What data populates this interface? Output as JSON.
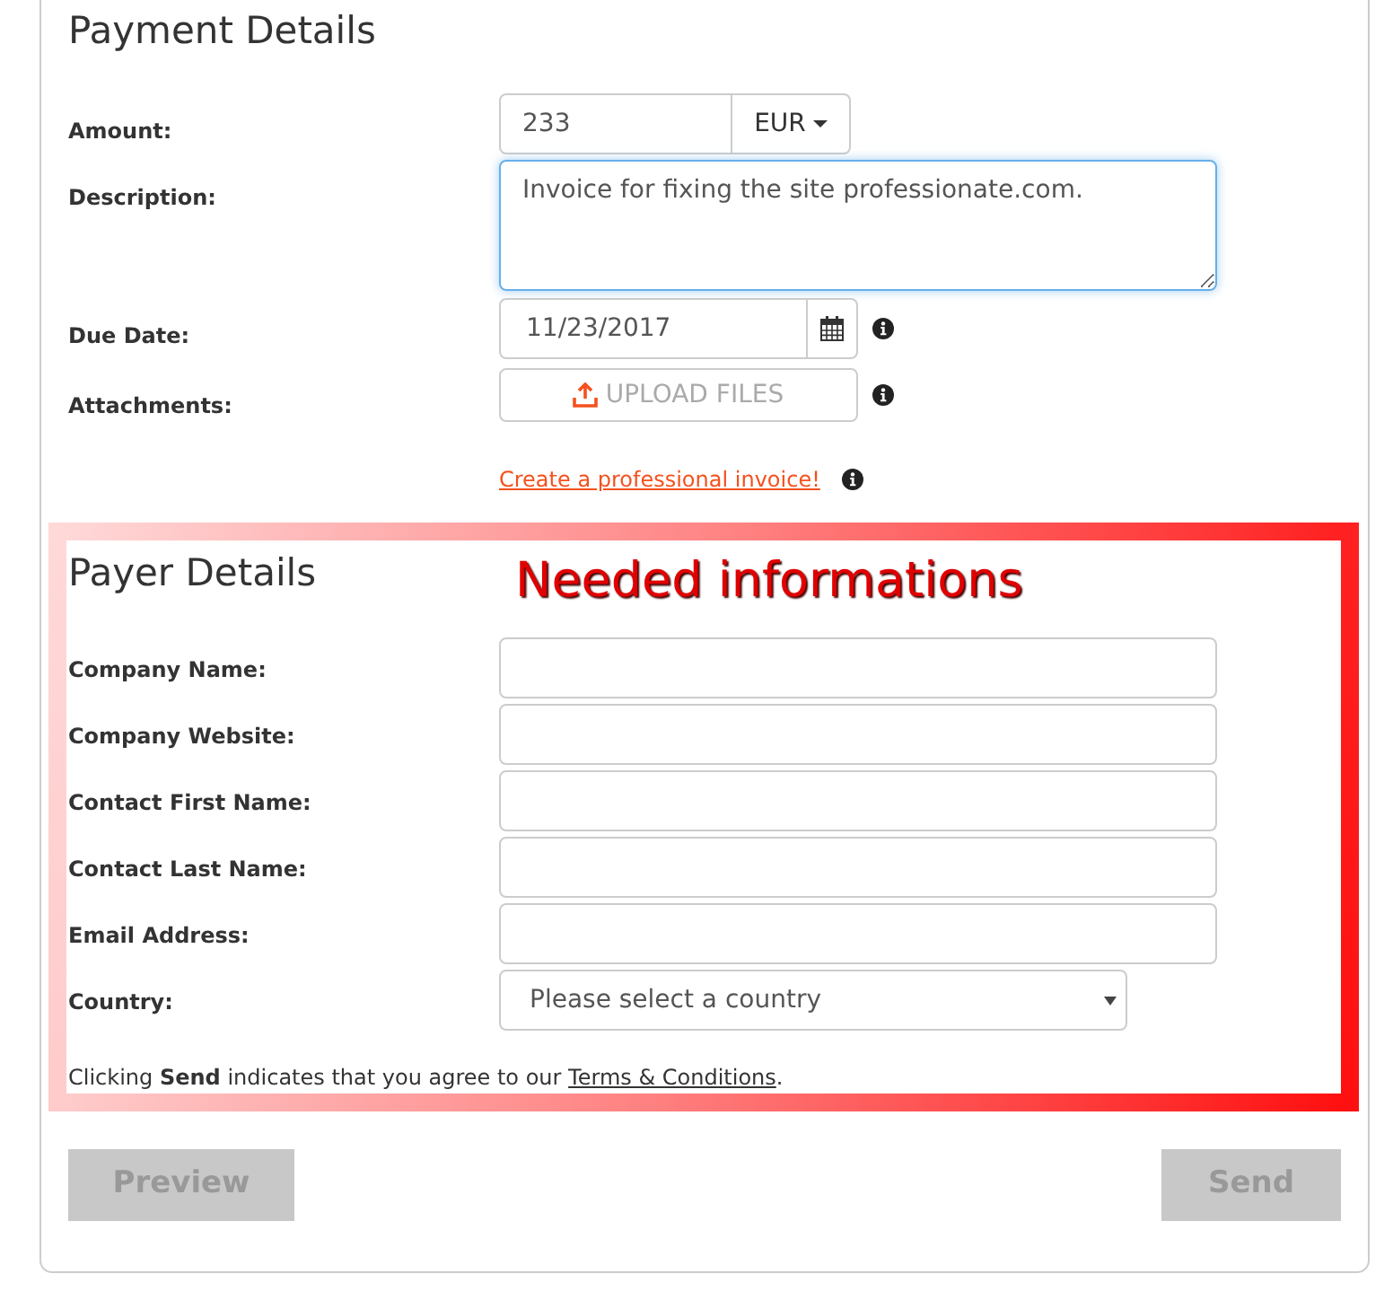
{
  "payment_details": {
    "title": "Payment Details",
    "fields": [
      {
        "kind": "amount",
        "label": "Amount:",
        "value": "233",
        "currency": "EUR"
      },
      {
        "kind": "textarea",
        "label": "Description:",
        "value": "Invoice for fixing the site professionate.com.",
        "focused": true
      },
      {
        "kind": "date",
        "label": "Due Date:",
        "value": "11/23/2017",
        "info": true
      },
      {
        "kind": "upload",
        "label": "Attachments:",
        "button": "UPLOAD FILES",
        "info": true
      }
    ],
    "invoice_link": {
      "text": "Create a professional invoice!",
      "info": true
    }
  },
  "payer_details": {
    "title": "Payer Details",
    "annotation": "Needed informations",
    "fields": [
      {
        "kind": "text",
        "label": "Company Name:"
      },
      {
        "kind": "text",
        "label": "Company Website:"
      },
      {
        "kind": "text",
        "label": "Contact First Name:"
      },
      {
        "kind": "text",
        "label": "Contact Last Name:"
      },
      {
        "kind": "text",
        "label": "Email Address:"
      },
      {
        "kind": "select",
        "label": "Country:",
        "placeholder": "Please select a country"
      }
    ],
    "terms": {
      "text": "Clicking **Send** indicates that you agree to our",
      "link": "Terms & Conditions",
      "end": "."
    }
  },
  "buttons": [
    {
      "label": "Preview",
      "disabled": true
    },
    {
      "label": "Send",
      "disabled": true
    }
  ]
}
